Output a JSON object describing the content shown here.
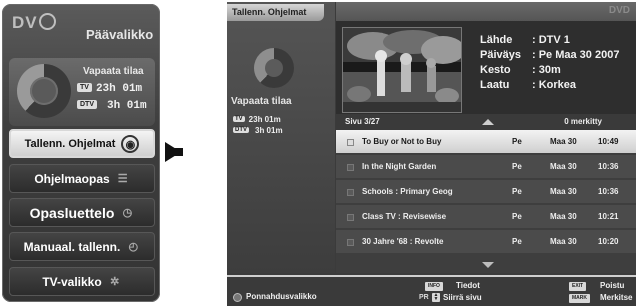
{
  "menu": {
    "logo": "DV",
    "title": "Päävalikko",
    "free_space_label": "Vapaata tilaa",
    "tv_tag": "TV",
    "tv_space": "23h 01m",
    "dtv_tag": "DTV",
    "dtv_space": "3h 01m",
    "items": [
      {
        "label": "Tallenn. Ohjelmat",
        "icon": "disc-icon"
      },
      {
        "label": "Ohjelmaopas",
        "icon": "list-icon"
      },
      {
        "label": "Opasluettelo",
        "icon": "clock-book-icon"
      },
      {
        "label": "Manuaal. tallenn.",
        "icon": "clock-hand-icon"
      },
      {
        "label": "TV-valikko",
        "icon": "gears-icon"
      }
    ]
  },
  "screen": {
    "tab_title": "Tallenn. Ohjelmat",
    "logo": "DVD",
    "side": {
      "free_space_label": "Vapaata tilaa",
      "tv_tag": "TV",
      "tv_space": "23h 01m",
      "dtv_tag": "DTV",
      "dtv_space": "3h 01m"
    },
    "info": {
      "source_key": "Lähde",
      "source_val": ": DTV 1",
      "date_key": "Päiväys",
      "date_val": ": Pe Maa 30 2007",
      "duration_key": "Kesto",
      "duration_val": ": 30m",
      "quality_key": "Laatu",
      "quality_val": ": Korkea"
    },
    "page_label": "Sivu  3/27",
    "marked_count": "0 merkitty",
    "rows": [
      {
        "title": "To Buy or Not to Buy",
        "day": "Pe",
        "date": "Maa 30",
        "time": "10:49"
      },
      {
        "title": "In the Night Garden",
        "day": "Pe",
        "date": "Maa 30",
        "time": "10:36"
      },
      {
        "title": "Schools : Primary Geog",
        "day": "Pe",
        "date": "Maa 30",
        "time": "10:36"
      },
      {
        "title": "Class TV : Revisewise",
        "day": "Pe",
        "date": "Maa 30",
        "time": "10:21"
      },
      {
        "title": "30 Jahre '68 : Revolte",
        "day": "Pe",
        "date": "Maa 30",
        "time": "10:20"
      }
    ],
    "footer": {
      "popup_label": "Ponnahdusvalikko",
      "info_btn": "INFO",
      "info_label": "Tiedot",
      "pr_label": "PR",
      "page_move_label": "Siirrä sivu",
      "exit_btn": "EXIT",
      "exit_label": "Poistu",
      "mark_btn": "MARK",
      "mark_label": "Merkitse"
    }
  }
}
